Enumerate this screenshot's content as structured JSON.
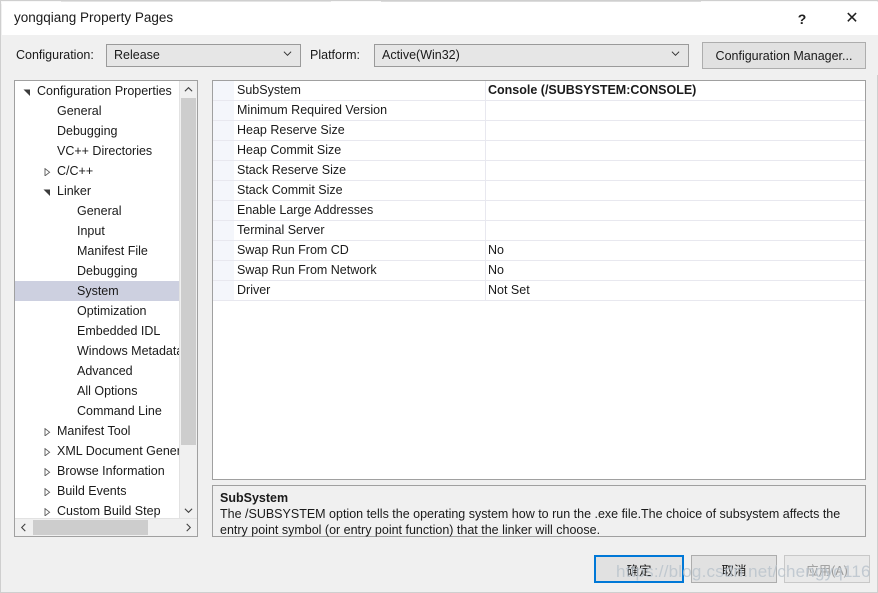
{
  "window": {
    "title": "yongqiang Property Pages",
    "help_icon": "?",
    "close_icon": "✕"
  },
  "configbar": {
    "configuration_label": "Configuration:",
    "configuration_value": "Release",
    "platform_label": "Platform:",
    "platform_value": "Active(Win32)",
    "configuration_manager_button": "Configuration Manager...",
    "chevron_icon": "chevron-down-icon"
  },
  "tree": {
    "items": [
      {
        "label": "Configuration Properties",
        "indent": 0,
        "state": "expanded",
        "selected": false
      },
      {
        "label": "General",
        "indent": 1,
        "state": "leaf",
        "selected": false
      },
      {
        "label": "Debugging",
        "indent": 1,
        "state": "leaf",
        "selected": false
      },
      {
        "label": "VC++ Directories",
        "indent": 1,
        "state": "leaf",
        "selected": false
      },
      {
        "label": "C/C++",
        "indent": 1,
        "state": "collapsed",
        "selected": false
      },
      {
        "label": "Linker",
        "indent": 1,
        "state": "expanded",
        "selected": false
      },
      {
        "label": "General",
        "indent": 2,
        "state": "leaf",
        "selected": false
      },
      {
        "label": "Input",
        "indent": 2,
        "state": "leaf",
        "selected": false
      },
      {
        "label": "Manifest File",
        "indent": 2,
        "state": "leaf",
        "selected": false
      },
      {
        "label": "Debugging",
        "indent": 2,
        "state": "leaf",
        "selected": false
      },
      {
        "label": "System",
        "indent": 2,
        "state": "leaf",
        "selected": true
      },
      {
        "label": "Optimization",
        "indent": 2,
        "state": "leaf",
        "selected": false
      },
      {
        "label": "Embedded IDL",
        "indent": 2,
        "state": "leaf",
        "selected": false
      },
      {
        "label": "Windows Metadata",
        "indent": 2,
        "state": "leaf",
        "selected": false
      },
      {
        "label": "Advanced",
        "indent": 2,
        "state": "leaf",
        "selected": false
      },
      {
        "label": "All Options",
        "indent": 2,
        "state": "leaf",
        "selected": false
      },
      {
        "label": "Command Line",
        "indent": 2,
        "state": "leaf",
        "selected": false
      },
      {
        "label": "Manifest Tool",
        "indent": 1,
        "state": "collapsed",
        "selected": false
      },
      {
        "label": "XML Document Generator",
        "indent": 1,
        "state": "collapsed",
        "selected": false
      },
      {
        "label": "Browse Information",
        "indent": 1,
        "state": "collapsed",
        "selected": false
      },
      {
        "label": "Build Events",
        "indent": 1,
        "state": "collapsed",
        "selected": false
      },
      {
        "label": "Custom Build Step",
        "indent": 1,
        "state": "collapsed",
        "selected": false
      }
    ],
    "expanded_icon": "triangle-down-icon",
    "collapsed_icon": "triangle-right-icon",
    "scroll_up_icon": "chevron-up-icon",
    "scroll_down_icon": "chevron-down-icon",
    "scroll_left_icon": "chevron-left-icon",
    "scroll_right_icon": "chevron-right-icon"
  },
  "grid": {
    "rows": [
      {
        "name": "SubSystem",
        "value": "Console (/SUBSYSTEM:CONSOLE)",
        "bold": true
      },
      {
        "name": "Minimum Required Version",
        "value": "",
        "bold": false
      },
      {
        "name": "Heap Reserve Size",
        "value": "",
        "bold": false
      },
      {
        "name": "Heap Commit Size",
        "value": "",
        "bold": false
      },
      {
        "name": "Stack Reserve Size",
        "value": "",
        "bold": false
      },
      {
        "name": "Stack Commit Size",
        "value": "",
        "bold": false
      },
      {
        "name": "Enable Large Addresses",
        "value": "",
        "bold": false
      },
      {
        "name": "Terminal Server",
        "value": "",
        "bold": false
      },
      {
        "name": "Swap Run From CD",
        "value": "No",
        "bold": false
      },
      {
        "name": "Swap Run From Network",
        "value": "No",
        "bold": false
      },
      {
        "name": "Driver",
        "value": "Not Set",
        "bold": false
      }
    ]
  },
  "description": {
    "title": "SubSystem",
    "body": "The /SUBSYSTEM option tells the operating system how to run the .exe file.The choice of subsystem affects the entry point symbol (or entry point function) that the linker will choose."
  },
  "footer": {
    "ok_label": "确定",
    "cancel_label": "取消",
    "apply_label": "应用(A)"
  },
  "watermark": {
    "text": "https://blog.csdn.net/chengyq116"
  },
  "colors": {
    "accent": "#0078d7",
    "selection": "#cdd0e0",
    "dialog_bg": "#f0f0f0",
    "pane_bg": "#ffffff"
  }
}
